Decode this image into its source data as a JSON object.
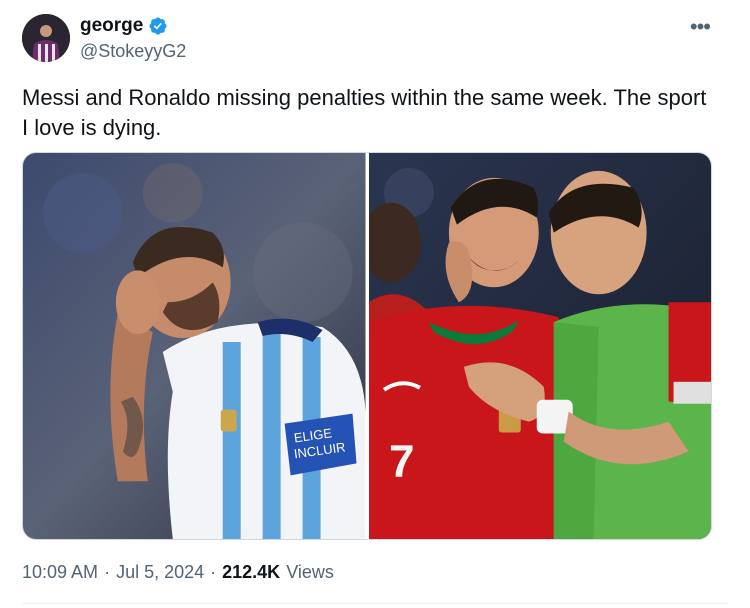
{
  "author": {
    "display_name": "george",
    "handle": "@StokeyyG2",
    "verified": true,
    "avatar_icon": "avatar-player-icon"
  },
  "tweet": {
    "text": "Messi and Ronaldo missing penalties within the same week. The sport I love is dying."
  },
  "media": {
    "left_photo": {
      "captain_band_text_line1": "ELIGE",
      "captain_band_text_line2": "INCLUIR"
    },
    "right_photo": {
      "shirt_number": "7"
    }
  },
  "meta": {
    "time": "10:09 AM",
    "separator": "·",
    "date": "Jul 5, 2024",
    "views_count": "212.4K",
    "views_label": "Views"
  },
  "colors": {
    "text_primary": "#0f1419",
    "text_secondary": "#536471",
    "verified_blue": "#1d9bf0",
    "border": "#cfd9de"
  },
  "icons": {
    "more": "more-options-icon",
    "verified": "verified-badge-icon"
  }
}
